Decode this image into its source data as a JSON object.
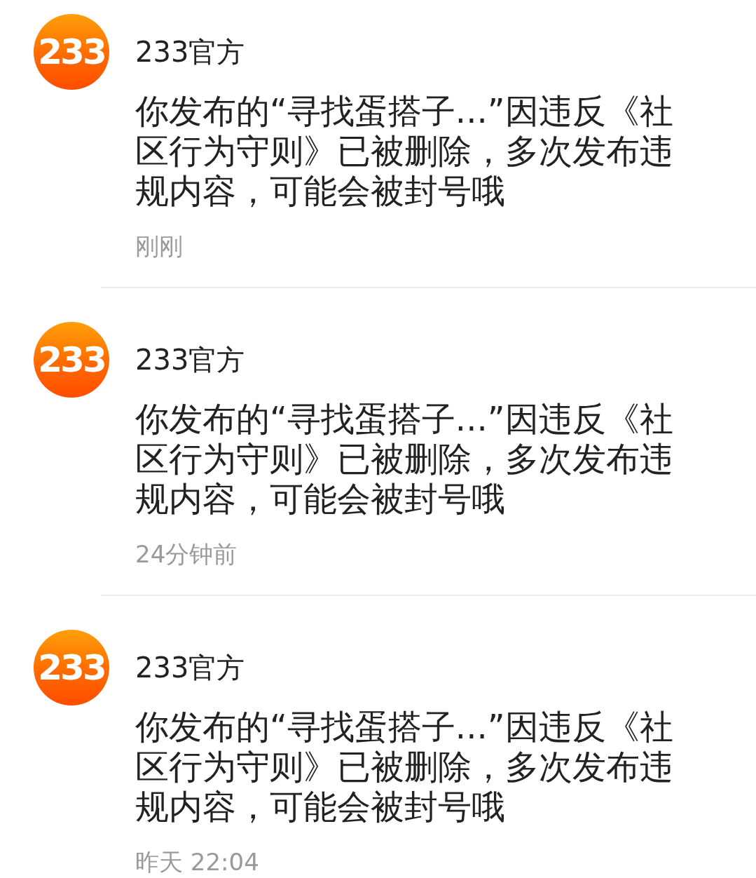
{
  "messages": [
    {
      "avatar_text": "233",
      "sender": "233官方",
      "text": "你发布的“寻找蛋搭子...”因违反《社区行为守则》已被删除，多次发布违规内容，可能会被封号哦",
      "time": "刚刚"
    },
    {
      "avatar_text": "233",
      "sender": "233官方",
      "text": "你发布的“寻找蛋搭子...”因违反《社区行为守则》已被删除，多次发布违规内容，可能会被封号哦",
      "time": "24分钟前"
    },
    {
      "avatar_text": "233",
      "sender": "233官方",
      "text": "你发布的“寻找蛋搭子...”因违反《社区行为守则》已被删除，多次发布违规内容，可能会被封号哦",
      "time": "昨天 22:04"
    }
  ]
}
